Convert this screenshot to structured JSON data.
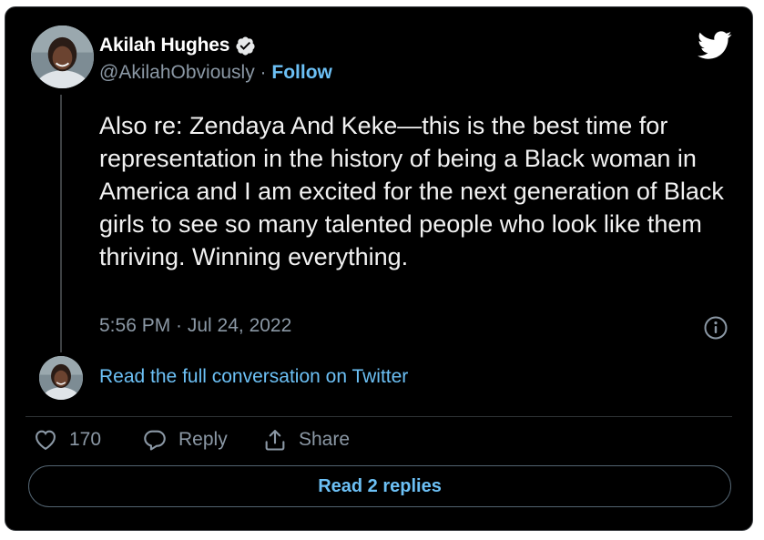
{
  "author": {
    "display_name": "Akilah Hughes",
    "handle": "@AkilahObviously",
    "separator": " · ",
    "follow_label": "Follow",
    "verified": true
  },
  "tweet": {
    "text": "Also re: Zendaya And Keke—this is the best time for representation in the history of being a Black woman in America and I am excited for the next generation of Black girls to see so many talented people who look like them thriving. Winning everything.",
    "timestamp": "5:56 PM · Jul 24, 2022"
  },
  "conversation_link": "Read the full conversation on Twitter",
  "actions": {
    "like_count": "170",
    "reply_label": "Reply",
    "share_label": "Share"
  },
  "read_replies_label": "Read 2 replies",
  "colors": {
    "background": "#000000",
    "text": "#f2f2f2",
    "muted": "#8b98a5",
    "link": "#6cc0f5",
    "twitter_brand": "#ffffff"
  },
  "icons": [
    "verified-badge-icon",
    "twitter-bird-icon",
    "info-icon",
    "heart-icon",
    "reply-bubble-icon",
    "share-icon"
  ]
}
